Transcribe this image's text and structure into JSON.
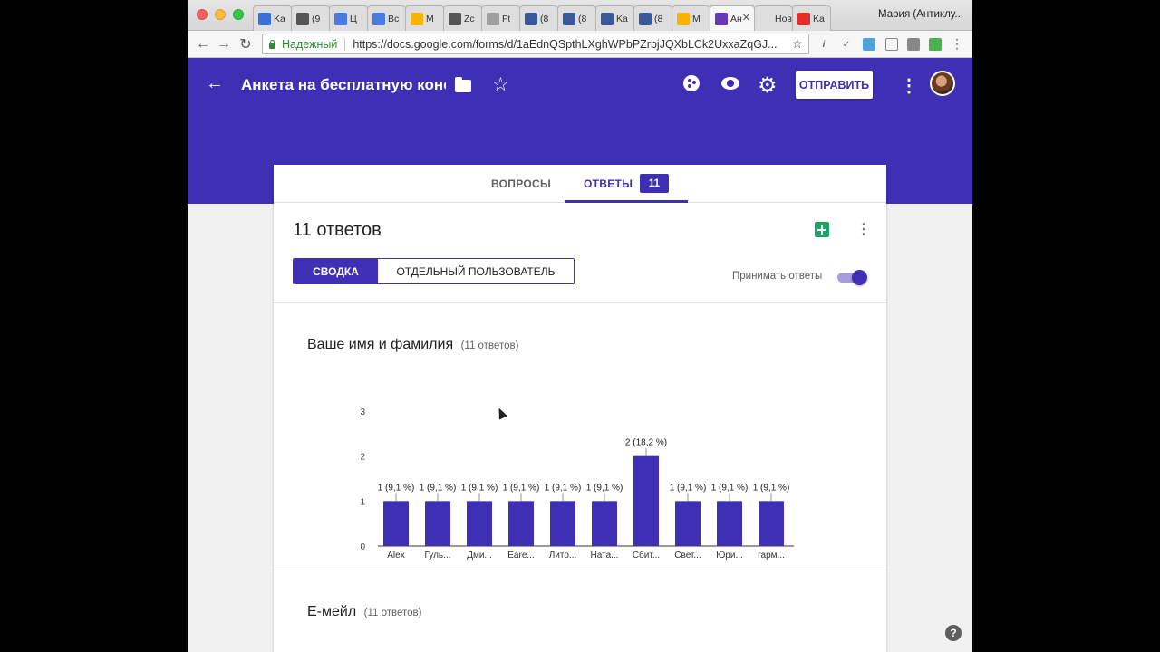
{
  "browser": {
    "tabs": [
      {
        "label": "Ka",
        "icon": "calendar-icon",
        "color": "#3b6fd8"
      },
      {
        "label": "(9",
        "icon": "window-icon",
        "color": "#555555"
      },
      {
        "label": "Ц",
        "icon": "docs-icon",
        "color": "#4a7be0"
      },
      {
        "label": "Bc",
        "icon": "docs-icon",
        "color": "#4a7be0"
      },
      {
        "label": "M",
        "icon": "drive-icon",
        "color": "#f4b400"
      },
      {
        "label": "Zc",
        "icon": "window-icon",
        "color": "#555555"
      },
      {
        "label": "Ft",
        "icon": "page-icon",
        "color": "#9e9e9e"
      },
      {
        "label": "(8",
        "icon": "facebook-icon",
        "color": "#3b5998"
      },
      {
        "label": "(8",
        "icon": "facebook-icon",
        "color": "#3b5998"
      },
      {
        "label": "Ka",
        "icon": "facebook-icon",
        "color": "#3b5998"
      },
      {
        "label": "(8",
        "icon": "facebook-icon",
        "color": "#3b5998"
      },
      {
        "label": "M",
        "icon": "drive-icon",
        "color": "#f4b400"
      },
      {
        "label": "Ан",
        "icon": "forms-icon",
        "color": "#673ab7",
        "active": true
      },
      {
        "label": "Новая",
        "icon": "none",
        "color": "#dddddd"
      },
      {
        "label": "Ka",
        "icon": "youtube-icon",
        "color": "#e52d27"
      }
    ],
    "profile_name": "Мария (Антиклу...",
    "secure_label": "Надежный",
    "url": "https://docs.google.com/forms/d/1aEdnQSpthLXghWPbPZrbjJQXbLCk2UxxaZqGJ..."
  },
  "header": {
    "title": "Анкета на бесплатную конс",
    "send_label": "ОТПРАВИТЬ",
    "brand_color": "#3f2fb5"
  },
  "tabs": {
    "questions": "ВОПРОСЫ",
    "responses": "ОТВЕТЫ",
    "responses_badge": "11"
  },
  "summary": {
    "count_title": "11 ответов",
    "summary_btn": "СВОДКА",
    "individual_btn": "ОТДЕЛЬНЫЙ ПОЛЬЗОВАТЕЛЬ",
    "accept_label": "Принимать ответы",
    "accepting": true
  },
  "questions": [
    {
      "title": "Ваше имя и фамилия",
      "count": "(11 ответов)"
    },
    {
      "title": "Е-мейл",
      "count": "(11 ответов)"
    }
  ],
  "chart_data": {
    "type": "bar",
    "categories": [
      "Alex",
      "Гуль...",
      "Дми...",
      "Eare...",
      "Лито...",
      "Ната...",
      "Сбит...",
      "Свет...",
      "Юри...",
      "гарм..."
    ],
    "values": [
      1,
      1,
      1,
      1,
      1,
      1,
      2,
      1,
      1,
      1
    ],
    "data_labels": [
      "1 (9,1 %)",
      "1 (9,1 %)",
      "1 (9,1 %)",
      "1 (9,1 %)",
      "1 (9,1 %)",
      "1 (9,1 %)",
      "2 (18,2 %)",
      "1 (9,1 %)",
      "1 (9,1 %)",
      "1 (9,1 %)"
    ],
    "yticks": [
      "0",
      "1",
      "2",
      "3"
    ],
    "ylim": [
      0,
      3
    ],
    "bar_color": "#3f2fb5",
    "title": "",
    "xlabel": "",
    "ylabel": ""
  }
}
